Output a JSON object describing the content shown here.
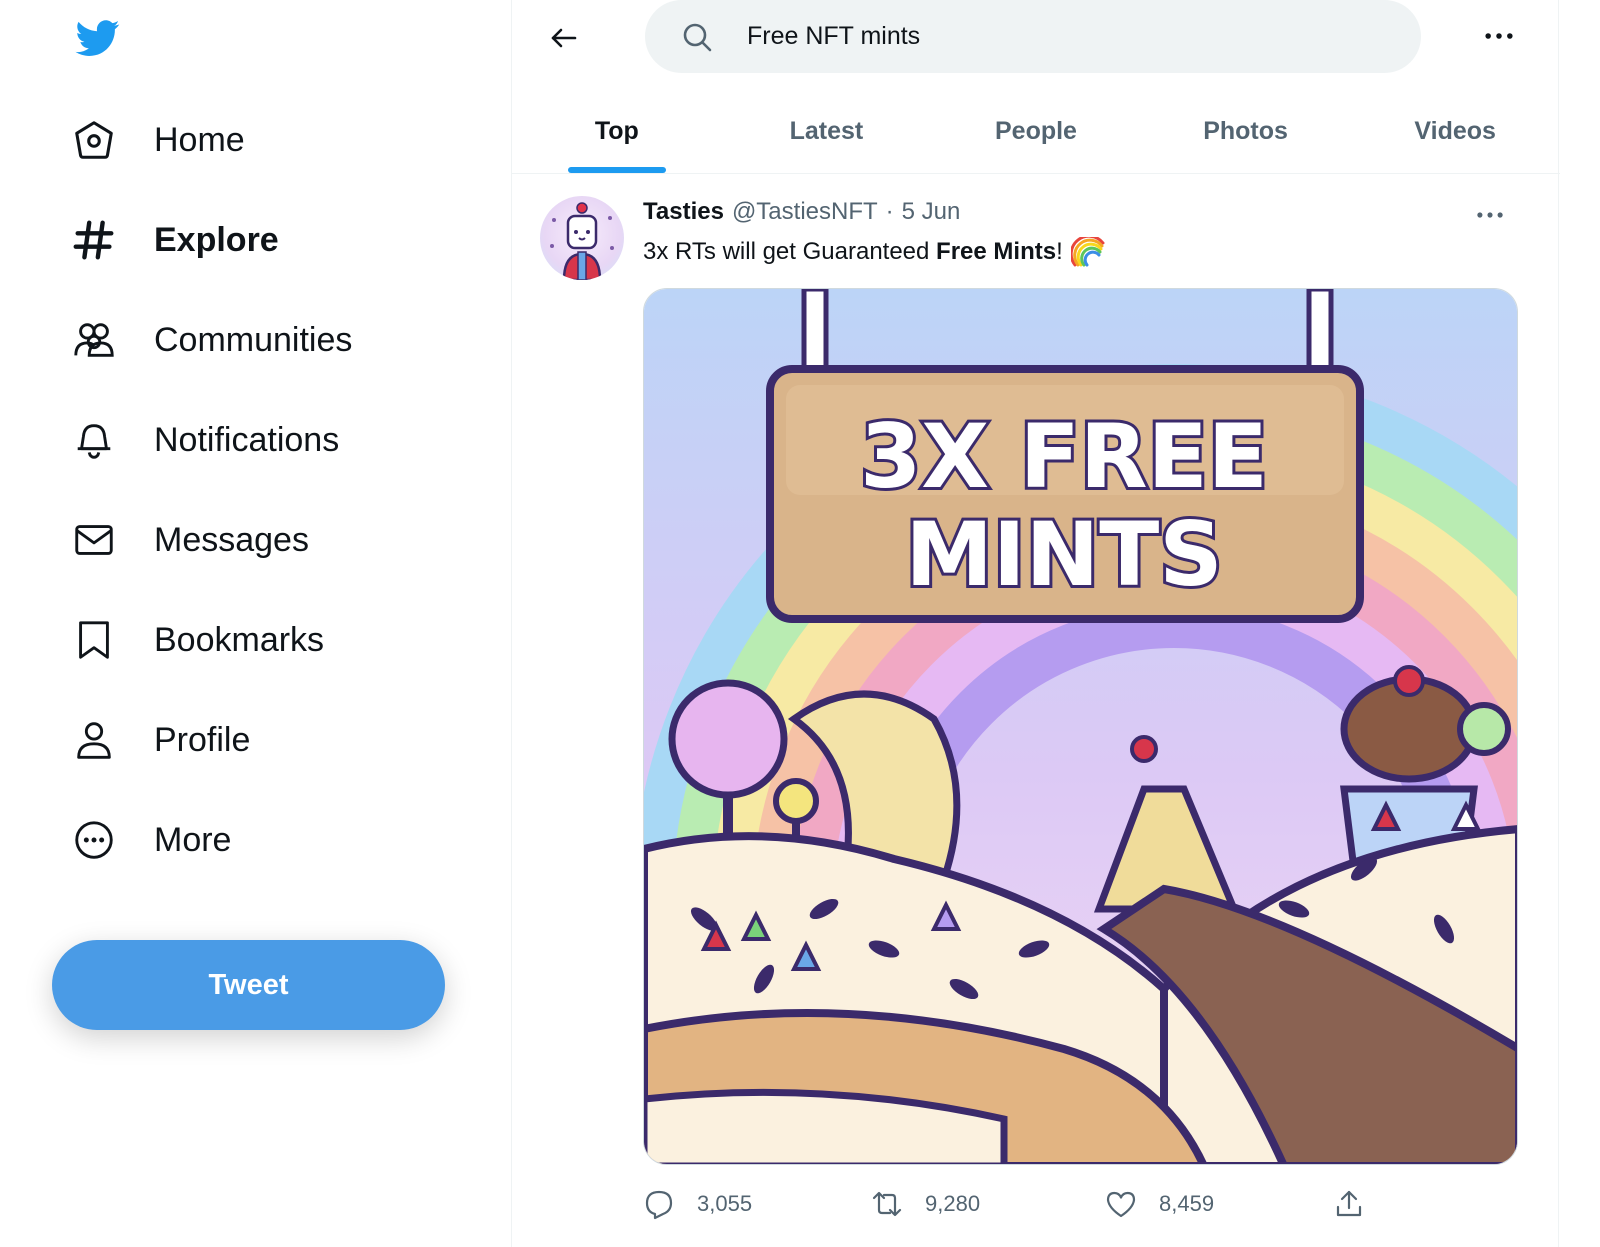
{
  "sidebar": {
    "logo_icon": "twitter-bird-icon",
    "items": [
      {
        "label": "Home",
        "icon": "home-icon"
      },
      {
        "label": "Explore",
        "icon": "hashtag-icon"
      },
      {
        "label": "Communities",
        "icon": "communities-icon"
      },
      {
        "label": "Notifications",
        "icon": "bell-icon"
      },
      {
        "label": "Messages",
        "icon": "envelope-icon"
      },
      {
        "label": "Bookmarks",
        "icon": "bookmark-icon"
      },
      {
        "label": "Profile",
        "icon": "person-icon"
      },
      {
        "label": "More",
        "icon": "more-circle-icon"
      }
    ],
    "active_item": "Explore",
    "tweet_button_label": "Tweet"
  },
  "search": {
    "query": "Free NFT mints"
  },
  "tabs": {
    "items": [
      "Top",
      "Latest",
      "People",
      "Photos",
      "Videos"
    ],
    "active": "Top"
  },
  "tweet": {
    "name": "Tasties",
    "handle": "@TastiesNFT",
    "separator": "·",
    "date": "5 Jun",
    "text_before": "3x RTs will get Guaranteed ",
    "text_bold": "Free Mints",
    "text_after": "!",
    "image_text_line1": "3X FREE",
    "image_text_line2": "MINTS",
    "replies": "3,055",
    "retweets": "9,280",
    "likes": "8,459"
  },
  "colors": {
    "accent": "#1d9bf0",
    "tweet_button": "#4a9be6",
    "text_primary": "#0f1419",
    "text_secondary": "#536471",
    "search_bg": "#eff3f4"
  }
}
